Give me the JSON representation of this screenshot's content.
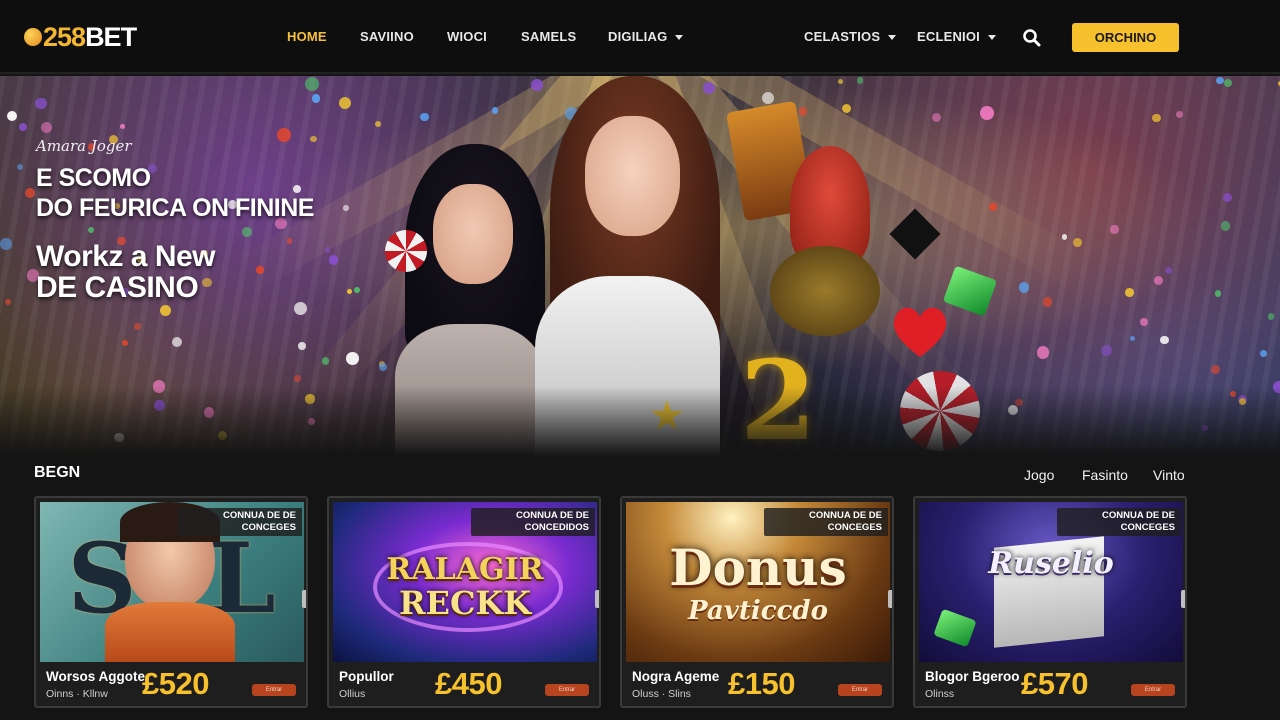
{
  "brand": {
    "logo_text_num": "258",
    "logo_text_word": "BET"
  },
  "nav": {
    "items": [
      {
        "label": "HOME",
        "active": true
      },
      {
        "label": "SAVIINO",
        "active": false
      },
      {
        "label": "WIOCI",
        "active": false
      },
      {
        "label": "SAMELS",
        "active": false
      },
      {
        "label": "DIGILIAG",
        "active": false,
        "dropdown": true
      },
      {
        "label": "CELASTIOS",
        "active": false,
        "dropdown": true
      },
      {
        "label": "ECLENIOI",
        "active": false,
        "dropdown": true
      }
    ],
    "search_icon": "search-icon",
    "cta_label": "ORCHINO"
  },
  "hero": {
    "kicker": "Amara Joger",
    "line1": "E SCOMO",
    "line2": "DO FEURICA ON FININE",
    "line3": "Workz a New",
    "line4": "DE CASINO"
  },
  "section": {
    "title": "BEGN",
    "filters": [
      "Jogo",
      "Fasinto",
      "Vinto"
    ]
  },
  "cards": [
    {
      "tag": "CONNUA DE DE CONCEGES",
      "art_text": "S L",
      "name": "Worsos Aggote",
      "sub": "Oinns · Kllnw",
      "price": "£520",
      "badge": "Entrar"
    },
    {
      "tag": "CONNUA DE DE CONCEDIDOS",
      "art_text_1": "RALAGIR",
      "art_text_2": "RECKK",
      "name": "Popullor",
      "sub": "Ollius",
      "price": "£450",
      "badge": "Entrar"
    },
    {
      "tag": "CONNUA DE DE CONCEGES",
      "art_text_1": "Donus",
      "art_text_2": "Pavticcdo",
      "name": "Nogra Ageme",
      "sub": "Oluss · Slins",
      "price": "£150",
      "badge": "Entrar"
    },
    {
      "tag": "CONNUA DE DE CONCEGES",
      "art_text": "Ruselio",
      "name": "Blogor Bgeroo",
      "sub": "Olinss",
      "price": "£570",
      "badge": "Entrar"
    }
  ],
  "colors": {
    "accent": "#f6c12c",
    "background": "#141414",
    "nav_bg": "#0e0e0e",
    "badge": "#b8431f"
  }
}
